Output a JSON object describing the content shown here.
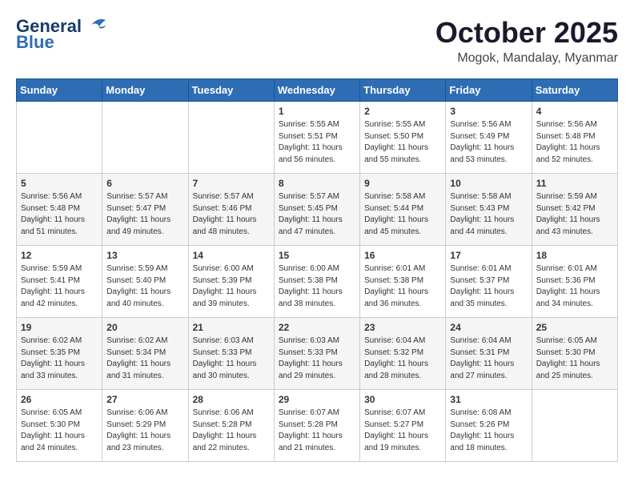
{
  "header": {
    "logo_general": "General",
    "logo_blue": "Blue",
    "month_year": "October 2025",
    "location": "Mogok, Mandalay, Myanmar"
  },
  "weekdays": [
    "Sunday",
    "Monday",
    "Tuesday",
    "Wednesday",
    "Thursday",
    "Friday",
    "Saturday"
  ],
  "weeks": [
    [
      {
        "day": "",
        "info": ""
      },
      {
        "day": "",
        "info": ""
      },
      {
        "day": "",
        "info": ""
      },
      {
        "day": "1",
        "info": "Sunrise: 5:55 AM\nSunset: 5:51 PM\nDaylight: 11 hours\nand 56 minutes."
      },
      {
        "day": "2",
        "info": "Sunrise: 5:55 AM\nSunset: 5:50 PM\nDaylight: 11 hours\nand 55 minutes."
      },
      {
        "day": "3",
        "info": "Sunrise: 5:56 AM\nSunset: 5:49 PM\nDaylight: 11 hours\nand 53 minutes."
      },
      {
        "day": "4",
        "info": "Sunrise: 5:56 AM\nSunset: 5:48 PM\nDaylight: 11 hours\nand 52 minutes."
      }
    ],
    [
      {
        "day": "5",
        "info": "Sunrise: 5:56 AM\nSunset: 5:48 PM\nDaylight: 11 hours\nand 51 minutes."
      },
      {
        "day": "6",
        "info": "Sunrise: 5:57 AM\nSunset: 5:47 PM\nDaylight: 11 hours\nand 49 minutes."
      },
      {
        "day": "7",
        "info": "Sunrise: 5:57 AM\nSunset: 5:46 PM\nDaylight: 11 hours\nand 48 minutes."
      },
      {
        "day": "8",
        "info": "Sunrise: 5:57 AM\nSunset: 5:45 PM\nDaylight: 11 hours\nand 47 minutes."
      },
      {
        "day": "9",
        "info": "Sunrise: 5:58 AM\nSunset: 5:44 PM\nDaylight: 11 hours\nand 45 minutes."
      },
      {
        "day": "10",
        "info": "Sunrise: 5:58 AM\nSunset: 5:43 PM\nDaylight: 11 hours\nand 44 minutes."
      },
      {
        "day": "11",
        "info": "Sunrise: 5:59 AM\nSunset: 5:42 PM\nDaylight: 11 hours\nand 43 minutes."
      }
    ],
    [
      {
        "day": "12",
        "info": "Sunrise: 5:59 AM\nSunset: 5:41 PM\nDaylight: 11 hours\nand 42 minutes."
      },
      {
        "day": "13",
        "info": "Sunrise: 5:59 AM\nSunset: 5:40 PM\nDaylight: 11 hours\nand 40 minutes."
      },
      {
        "day": "14",
        "info": "Sunrise: 6:00 AM\nSunset: 5:39 PM\nDaylight: 11 hours\nand 39 minutes."
      },
      {
        "day": "15",
        "info": "Sunrise: 6:00 AM\nSunset: 5:38 PM\nDaylight: 11 hours\nand 38 minutes."
      },
      {
        "day": "16",
        "info": "Sunrise: 6:01 AM\nSunset: 5:38 PM\nDaylight: 11 hours\nand 36 minutes."
      },
      {
        "day": "17",
        "info": "Sunrise: 6:01 AM\nSunset: 5:37 PM\nDaylight: 11 hours\nand 35 minutes."
      },
      {
        "day": "18",
        "info": "Sunrise: 6:01 AM\nSunset: 5:36 PM\nDaylight: 11 hours\nand 34 minutes."
      }
    ],
    [
      {
        "day": "19",
        "info": "Sunrise: 6:02 AM\nSunset: 5:35 PM\nDaylight: 11 hours\nand 33 minutes."
      },
      {
        "day": "20",
        "info": "Sunrise: 6:02 AM\nSunset: 5:34 PM\nDaylight: 11 hours\nand 31 minutes."
      },
      {
        "day": "21",
        "info": "Sunrise: 6:03 AM\nSunset: 5:33 PM\nDaylight: 11 hours\nand 30 minutes."
      },
      {
        "day": "22",
        "info": "Sunrise: 6:03 AM\nSunset: 5:33 PM\nDaylight: 11 hours\nand 29 minutes."
      },
      {
        "day": "23",
        "info": "Sunrise: 6:04 AM\nSunset: 5:32 PM\nDaylight: 11 hours\nand 28 minutes."
      },
      {
        "day": "24",
        "info": "Sunrise: 6:04 AM\nSunset: 5:31 PM\nDaylight: 11 hours\nand 27 minutes."
      },
      {
        "day": "25",
        "info": "Sunrise: 6:05 AM\nSunset: 5:30 PM\nDaylight: 11 hours\nand 25 minutes."
      }
    ],
    [
      {
        "day": "26",
        "info": "Sunrise: 6:05 AM\nSunset: 5:30 PM\nDaylight: 11 hours\nand 24 minutes."
      },
      {
        "day": "27",
        "info": "Sunrise: 6:06 AM\nSunset: 5:29 PM\nDaylight: 11 hours\nand 23 minutes."
      },
      {
        "day": "28",
        "info": "Sunrise: 6:06 AM\nSunset: 5:28 PM\nDaylight: 11 hours\nand 22 minutes."
      },
      {
        "day": "29",
        "info": "Sunrise: 6:07 AM\nSunset: 5:28 PM\nDaylight: 11 hours\nand 21 minutes."
      },
      {
        "day": "30",
        "info": "Sunrise: 6:07 AM\nSunset: 5:27 PM\nDaylight: 11 hours\nand 19 minutes."
      },
      {
        "day": "31",
        "info": "Sunrise: 6:08 AM\nSunset: 5:26 PM\nDaylight: 11 hours\nand 18 minutes."
      },
      {
        "day": "",
        "info": ""
      }
    ]
  ]
}
